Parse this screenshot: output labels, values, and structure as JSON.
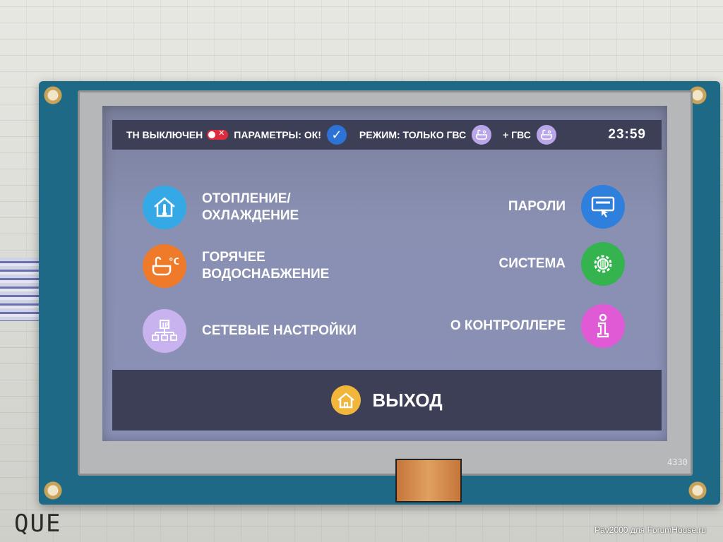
{
  "status_bar": {
    "heat_pump_status": "ТН ВЫКЛЮЧЕН",
    "params_label": "ПАРАМЕТРЫ: ОК!",
    "mode_label": "РЕЖИМ: ТОЛЬКО ГВС",
    "dhw_label": "+ ГВС",
    "clock": "23:59",
    "toggle_state": "off",
    "toggle_color": "#e02a3e"
  },
  "menu": {
    "heating": {
      "label": "ОТОПЛЕНИЕ/\nОХЛАЖДЕНИЕ",
      "icon": "house-thermometer-icon",
      "color": "#35a8e6"
    },
    "hot_water": {
      "label": "ГОРЯЧЕЕ\nВОДОСНАБЖЕНИЕ",
      "icon": "bath-temperature-icon",
      "color": "#ee7a2a"
    },
    "network": {
      "label": "СЕТЕВЫЕ НАСТРОЙКИ",
      "icon": "network-ip-icon",
      "color": "#c9b3ef"
    },
    "passwords": {
      "label": "ПАРОЛИ",
      "icon": "password-card-icon",
      "color": "#2f7fdc"
    },
    "system": {
      "label": "СИСТЕМА",
      "icon": "gear-chip-icon",
      "color": "#34b34f"
    },
    "about": {
      "label": "О КОНТРОЛЛЕРЕ",
      "icon": "info-icon",
      "color": "#e05ad6"
    }
  },
  "exit": {
    "label": "ВЫХОД",
    "icon": "home-exit-icon",
    "color": "#f1b63a"
  },
  "board_tag": "4330",
  "photo_credit": "Pav2000 для ForumHouse.ru",
  "paper_text": "QUE"
}
